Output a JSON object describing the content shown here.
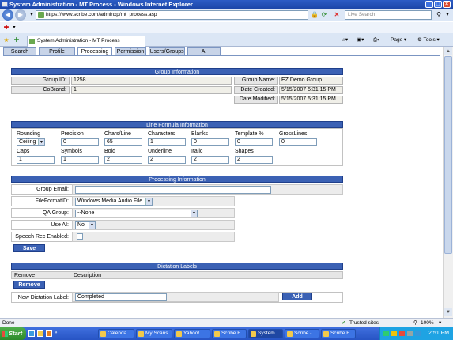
{
  "window": {
    "title": "System Administration - MT Process - Windows Internet Explorer"
  },
  "address_bar": {
    "url": "https://www.scribe.com/adminxp/mt_process.asp",
    "search_placeholder": "Live Search"
  },
  "browser_tab": {
    "title": "System Administration - MT Process"
  },
  "toolbar": {
    "page_label": "Page",
    "tools_label": "Tools"
  },
  "app_tabs": [
    "Search",
    "Profile",
    "Processing",
    "Permission",
    "Users/Groups",
    "AI"
  ],
  "group_info": {
    "header": "Group Information",
    "group_id_label": "Group ID:",
    "group_id": "1258",
    "cobrand_label": "CoBrand:",
    "cobrand": "1",
    "group_name_label": "Group Name:",
    "group_name": "EZ Demo Group",
    "date_created_label": "Date Created:",
    "date_created": "5/15/2007 5:31:15 PM",
    "date_modified_label": "Date Modified:",
    "date_modified": "5/15/2007 5:31:15 PM"
  },
  "line_formula": {
    "header": "Line Formula Information",
    "rounding_label": "Rounding",
    "rounding": "Ceiling",
    "precision_label": "Precision",
    "precision": "0",
    "chars_line_label": "Chars/Line",
    "chars_line": "65",
    "characters_label": "Characters",
    "characters": "1",
    "blanks_label": "Blanks",
    "blanks": "0",
    "template_label": "Template %",
    "template": "0",
    "grosslines_label": "GrossLines",
    "grosslines": "0",
    "caps_label": "Caps",
    "caps": "1",
    "symbols_label": "Symbols",
    "symbols": "1",
    "bold_label": "Bold",
    "bold": "2",
    "underline_label": "Underline",
    "underline": "2",
    "italic_label": "Italic",
    "italic": "2",
    "shapes_label": "Shapes",
    "shapes": "2"
  },
  "processing": {
    "header": "Processing Information",
    "group_email_label": "Group Email:",
    "group_email": "",
    "file_format_label": "FileFormatID:",
    "file_format": "Windows Media Audio File",
    "qa_group_label": "QA Group:",
    "qa_group": "--None",
    "use_ai_label": "Use AI:",
    "use_ai": "No",
    "speech_rec_label": "Speech Rec Enabled:",
    "save_label": "Save"
  },
  "dictation": {
    "header": "Dictation Labels",
    "col_remove": "Remove",
    "col_description": "Description",
    "remove_label": "Remove",
    "new_label_label": "New Dictation Label:",
    "new_label_value": "Completed",
    "add_label": "Add"
  },
  "status_bar": {
    "status": "Done",
    "zone": "Trusted sites",
    "zoom": "100%"
  },
  "taskbar": {
    "start_label": "Start",
    "items": [
      "Calenda...",
      "My Scans",
      "Yahoo! ...",
      "Scribe E...",
      "System...",
      "Scribe -...",
      "Scribe E..."
    ],
    "clock": "2:51 PM"
  }
}
